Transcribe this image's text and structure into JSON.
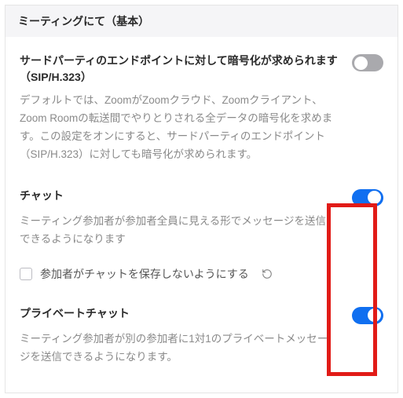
{
  "header": {
    "title": "ミーティングにて（基本）"
  },
  "settings": {
    "encryption": {
      "title": "サードパーティのエンドポイントに対して暗号化が求められます（SIP/H.323）",
      "desc": "デフォルトでは、ZoomがZoomクラウド、Zoomクライアント、Zoom Roomの転送間でやりとりされる全データの暗号化を求めます。この設定をオンにすると、サードパーティのエンドポイント（SIP/H.323）に対しても暗号化が求められます。",
      "enabled": false
    },
    "chat": {
      "title": "チャット",
      "desc": "ミーティング参加者が参加者全員に見える形でメッセージを送信できるようになります",
      "enabled": true,
      "suboption_label": "参加者がチャットを保存しないようにする",
      "suboption_checked": false
    },
    "private_chat": {
      "title": "プライベートチャット",
      "desc": "ミーティング参加者が別の参加者に1対1のプライベートメッセージを送信できるようになります。",
      "enabled": true
    }
  },
  "colors": {
    "accent": "#106ff0",
    "highlight": "#e11b17"
  }
}
